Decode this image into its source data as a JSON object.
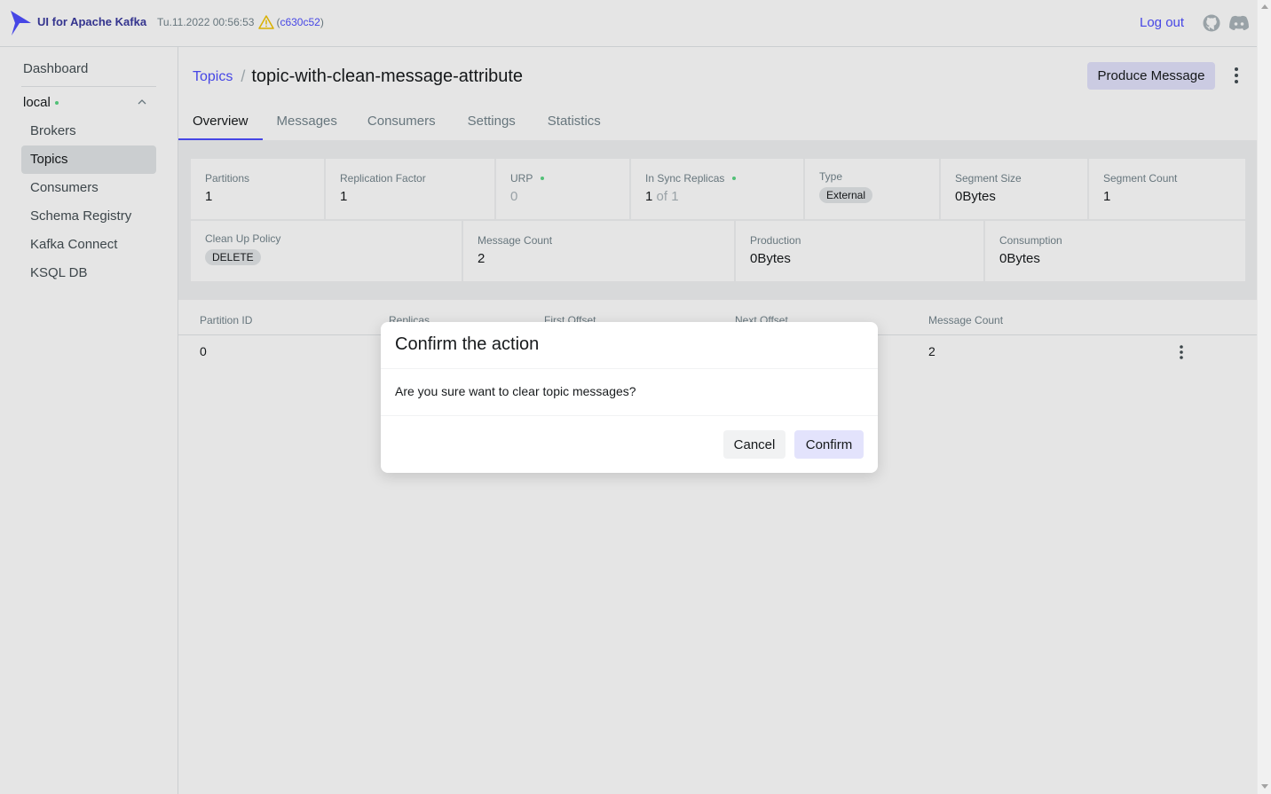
{
  "brand": {
    "name": "UI for Apache Kafka",
    "build_time": "Tu.11.2022 00:56:53",
    "commit_open": "(",
    "commit": "c630c52",
    "commit_close": ")"
  },
  "header": {
    "logout_label": "Log out",
    "icons": [
      "kafka-logo",
      "warning-icon",
      "github-icon",
      "discord-icon"
    ]
  },
  "sidebar": {
    "dashboard": "Dashboard",
    "cluster": {
      "name": "local",
      "status_color": "#5cd685"
    },
    "items": [
      {
        "label": "Brokers",
        "active": false
      },
      {
        "label": "Topics",
        "active": true
      },
      {
        "label": "Consumers",
        "active": false
      },
      {
        "label": "Schema Registry",
        "active": false
      },
      {
        "label": "Kafka Connect",
        "active": false
      },
      {
        "label": "KSQL DB",
        "active": false
      }
    ]
  },
  "page": {
    "breadcrumb_link": "Topics",
    "breadcrumb_sep": "/",
    "title": "topic-with-clean-message-attribute",
    "produce_label": "Produce Message"
  },
  "tabs": [
    "Overview",
    "Messages",
    "Consumers",
    "Settings",
    "Statistics"
  ],
  "active_tab": "Overview",
  "metrics_row1": [
    {
      "label": "Partitions",
      "value": "1"
    },
    {
      "label": "Replication Factor",
      "value": "1"
    },
    {
      "label": "URP",
      "value": "0"
    },
    {
      "label": "In Sync Replicas",
      "value": "1",
      "value_suffix": " of 1"
    },
    {
      "label": "Type",
      "tag": "External"
    },
    {
      "label": "Segment Size",
      "value": "0Bytes"
    },
    {
      "label": "Segment Count",
      "value": "1"
    }
  ],
  "metrics_row2": [
    {
      "label": "Clean Up Policy",
      "tag": "DELETE"
    },
    {
      "label": "Message Count",
      "value": "2"
    },
    {
      "label": "Production",
      "value": "0Bytes"
    },
    {
      "label": "Consumption",
      "value": "0Bytes"
    }
  ],
  "table": {
    "columns": [
      "Partition ID",
      "Replicas",
      "First Offset",
      "Next Offset",
      "Message Count"
    ],
    "rows": [
      {
        "partition_id": "0",
        "message_count": "2"
      }
    ]
  },
  "modal": {
    "title": "Confirm the action",
    "body": "Are you sure want to clear topic messages?",
    "cancel_label": "Cancel",
    "confirm_label": "Confirm"
  },
  "colors": {
    "accent": "#4f4fff",
    "brand": "#3a3a9f",
    "status_ok": "#5cd685",
    "primary_button": "#e3e3fc"
  }
}
